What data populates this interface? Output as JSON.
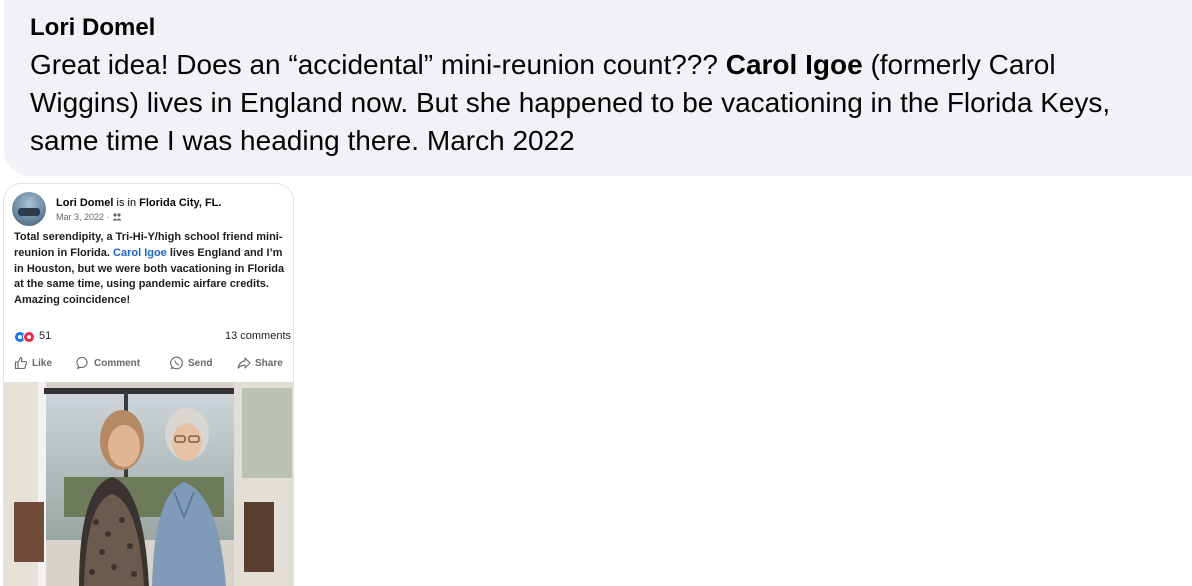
{
  "comment": {
    "author": "Lori Domel",
    "text_before": "Great idea! Does an “accidental” mini-reunion count???",
    "mention": "Carol Igoe",
    "text_after": "(formerly Carol Wiggins) lives in England now. But she happened to be vacationing in the Florida Keys, same time I was heading there. March 2022"
  },
  "shared_post": {
    "author": "Lori Domel",
    "is_in": "is in",
    "location": "Florida City, FL.",
    "date": "Mar 3, 2022 ·",
    "audience_icon": "friends-icon",
    "body_before": "Total serendipity, a Tri-Hi-Y/high school friend mini-reunion in Florida.",
    "body_tag": "Carol Igoe",
    "body_after": "lives England and I’m in Houston, but we were both vacationing in Florida at the same time, using pandemic airfare credits. Amazing coincidence!",
    "reaction_count": "51",
    "comments_count": "13 comments",
    "actions": {
      "like": "Like",
      "comment": "Comment",
      "send": "Send",
      "share": "Share"
    },
    "colors": {
      "link": "#1b66c9",
      "like_blue": "#1877f2",
      "love_red": "#f02849"
    }
  }
}
